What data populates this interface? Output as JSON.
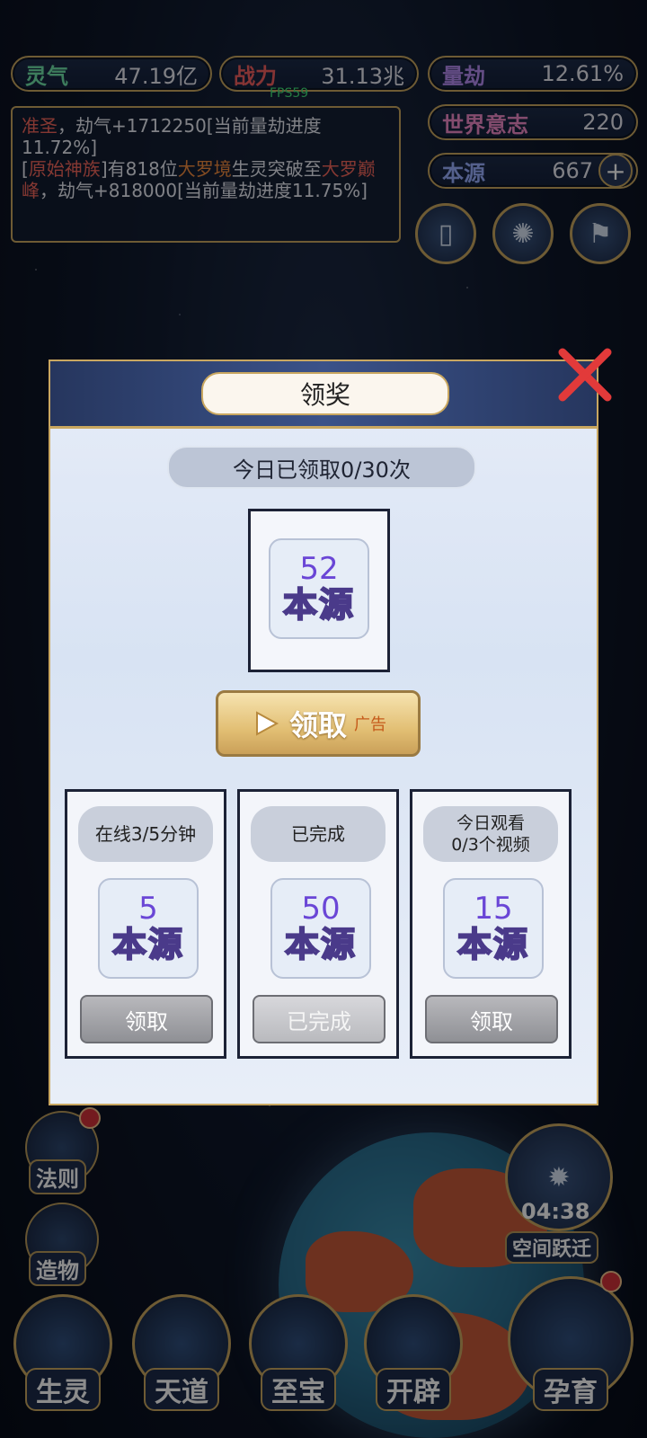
{
  "resources": {
    "lingqi": {
      "label": "灵气",
      "value": "47.19亿"
    },
    "zhanli": {
      "label": "战力",
      "value": "31.13兆"
    },
    "liangjie": {
      "label": "量劫",
      "value": "12.61%"
    },
    "shijie": {
      "label": "世界意志",
      "value": "220"
    },
    "benyuan": {
      "label": "本源",
      "value": "667"
    }
  },
  "fps": "FPS59",
  "log": {
    "line1_red": "准圣",
    "line1_rest": "，劫气+1712250[当前量劫进度11.72%]",
    "line2_open": "[",
    "line2_red1": "原始神族",
    "line2_mid": "]有818位",
    "line2_orange": "大罗境",
    "line2_mid2": "生灵突破至",
    "line2_red2": "大罗巅峰",
    "line2_rest": "，劫气+818000[当前量劫进度11.75%]"
  },
  "side_labels": {
    "fa_ze": "法则",
    "zao_wu": "造物"
  },
  "space_jump": {
    "timer": "04:38",
    "label": "空间跃迁"
  },
  "bottom_nav": [
    "生灵",
    "天道",
    "至宝",
    "开辟",
    "孕育"
  ],
  "modal": {
    "title": "领奖",
    "daily_count": "今日已领取0/30次",
    "main_reward": {
      "amount": "52",
      "name": "本源"
    },
    "ad_button": {
      "label": "领取",
      "tag": "广告"
    },
    "tasks": [
      {
        "title": "在线3/5分钟",
        "amount": "5",
        "name": "本源",
        "button": "领取"
      },
      {
        "title": "已完成",
        "amount": "50",
        "name": "本源",
        "button": "已完成"
      },
      {
        "title": "今日观看\n0/3个视频",
        "amount": "15",
        "name": "本源",
        "button": "领取"
      }
    ]
  }
}
